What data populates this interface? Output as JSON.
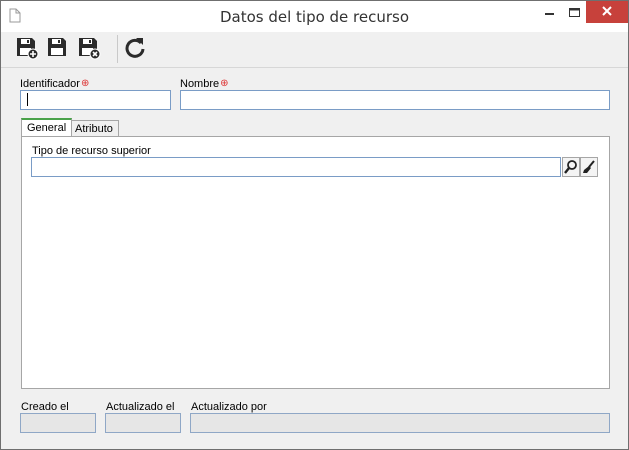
{
  "window": {
    "title": "Datos del tipo de recurso"
  },
  "toolbar": {
    "buttons": [
      {
        "name": "save-and-new",
        "icon": "floppy-plus-icon"
      },
      {
        "name": "save",
        "icon": "floppy-icon"
      },
      {
        "name": "save-and-close",
        "icon": "floppy-close-icon"
      },
      {
        "name": "refresh",
        "icon": "refresh-icon"
      }
    ]
  },
  "form": {
    "identifier": {
      "label": "Identificador",
      "required_mark": "⊕",
      "value": ""
    },
    "name": {
      "label": "Nombre",
      "required_mark": "⊕",
      "value": ""
    }
  },
  "tabs": [
    {
      "label": "General",
      "active": true
    },
    {
      "label": "Atributo",
      "active": false
    }
  ],
  "general": {
    "parent_type": {
      "label": "Tipo de recurso superior",
      "value": ""
    }
  },
  "footer": {
    "created": {
      "label": "Creado el",
      "value": ""
    },
    "updated": {
      "label": "Actualizado el",
      "value": ""
    },
    "updated_by": {
      "label": "Actualizado por",
      "value": ""
    }
  },
  "colors": {
    "accent_tab": "#4aa24a",
    "close_button": "#c7413b",
    "required": "#dd3333"
  }
}
